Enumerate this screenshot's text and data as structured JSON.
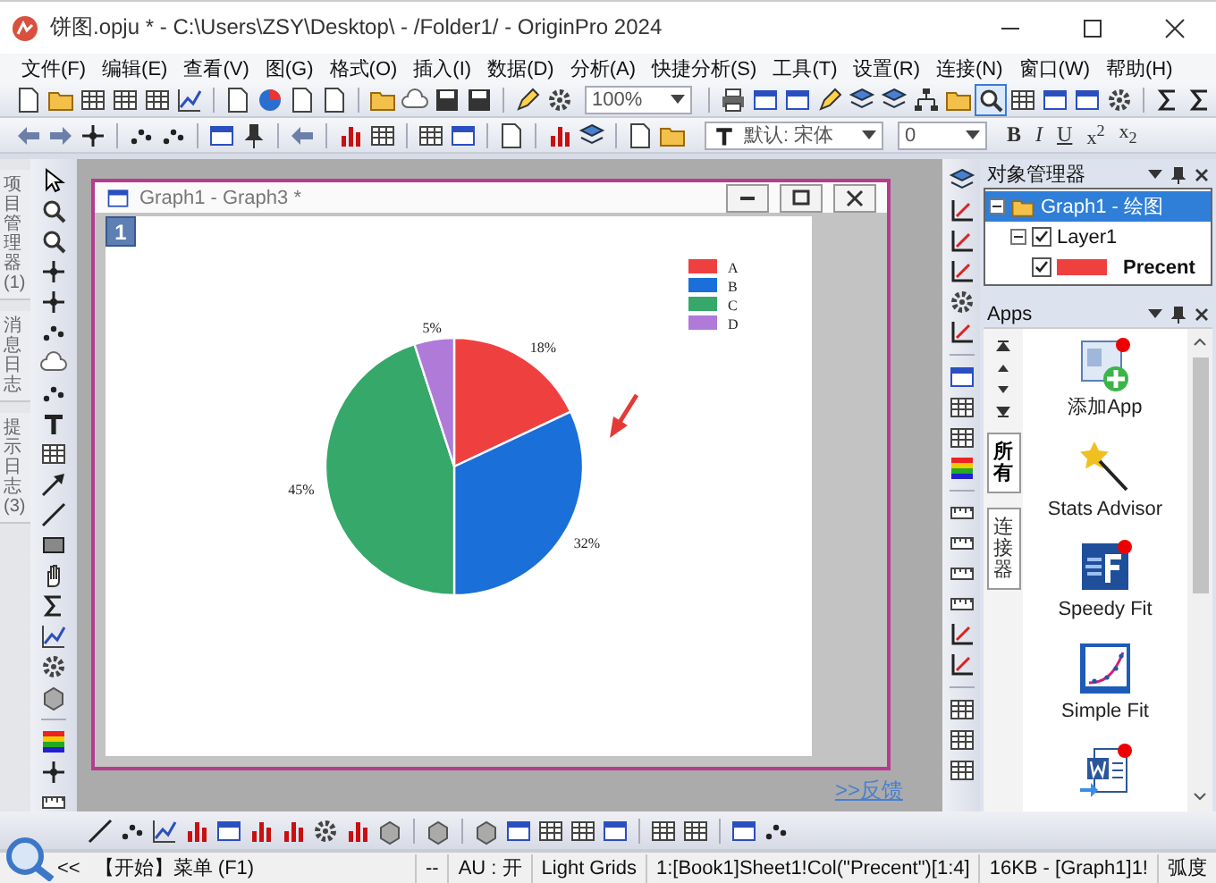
{
  "window": {
    "title": "饼图.opju * - C:\\Users\\ZSY\\Desktop\\ - /Folder1/ - OriginPro 2024"
  },
  "menu": [
    "文件(F)",
    "编辑(E)",
    "查看(V)",
    "图(G)",
    "格式(O)",
    "插入(I)",
    "数据(D)",
    "分析(A)",
    "快捷分析(S)",
    "工具(T)",
    "设置(R)",
    "连接(N)",
    "窗口(W)",
    "帮助(H)"
  ],
  "toolbar": {
    "zoom": "100%",
    "font": "默认: 宋体",
    "font_size": "0",
    "format_buttons": [
      "B",
      "I",
      "U",
      "x$^{2}$",
      "x$_{2}$"
    ]
  },
  "side_tabs": [
    {
      "label": "项目管理器 (1)"
    },
    {
      "label": "消息日志"
    },
    {
      "label": "提示日志 (3)"
    }
  ],
  "graph_window": {
    "title": "Graph1 - Graph3 *",
    "layer": "1",
    "chart_data": {
      "type": "pie",
      "categories": [
        "A",
        "B",
        "C",
        "D"
      ],
      "values": [
        18,
        32,
        45,
        5
      ],
      "colors": [
        "#ef4040",
        "#1a6fd9",
        "#35a86a",
        "#b07ad8"
      ],
      "value_labels": [
        "18%",
        "32%",
        "45%",
        "5%"
      ],
      "legend": "top-right"
    }
  },
  "feedback_link": ">>反馈",
  "object_manager": {
    "title": "对象管理器",
    "tree": [
      {
        "label": "Graph1 - 绘图",
        "expanded": true,
        "selected": true,
        "children": [
          {
            "label": "Layer1",
            "expanded": true,
            "selected": false,
            "checked": true,
            "children": [
              {
                "label": "Precent",
                "selected": false,
                "checked": true,
                "color": "#ef4040"
              }
            ]
          }
        ]
      }
    ]
  },
  "apps": {
    "title": "Apps",
    "tabs": [
      {
        "label": "所有",
        "selected": true
      },
      {
        "label": "连接器",
        "selected": false
      }
    ],
    "items": [
      {
        "kind": "add",
        "label": "添加App"
      },
      {
        "kind": "wizard",
        "label": "Stats Advisor"
      },
      {
        "kind": "speedy",
        "label": "Speedy Fit"
      },
      {
        "kind": "fit",
        "label": "Simple Fit"
      },
      {
        "kind": "word"
      }
    ]
  },
  "status_bar": [
    "<<",
    "【开始】菜单 (F1)",
    "--",
    "AU : 开",
    "Light Grids",
    "1:[Book1]Sheet1!Col(\"Precent\")[1:4]",
    "16KB - [Graph1]1!",
    "弧度"
  ]
}
